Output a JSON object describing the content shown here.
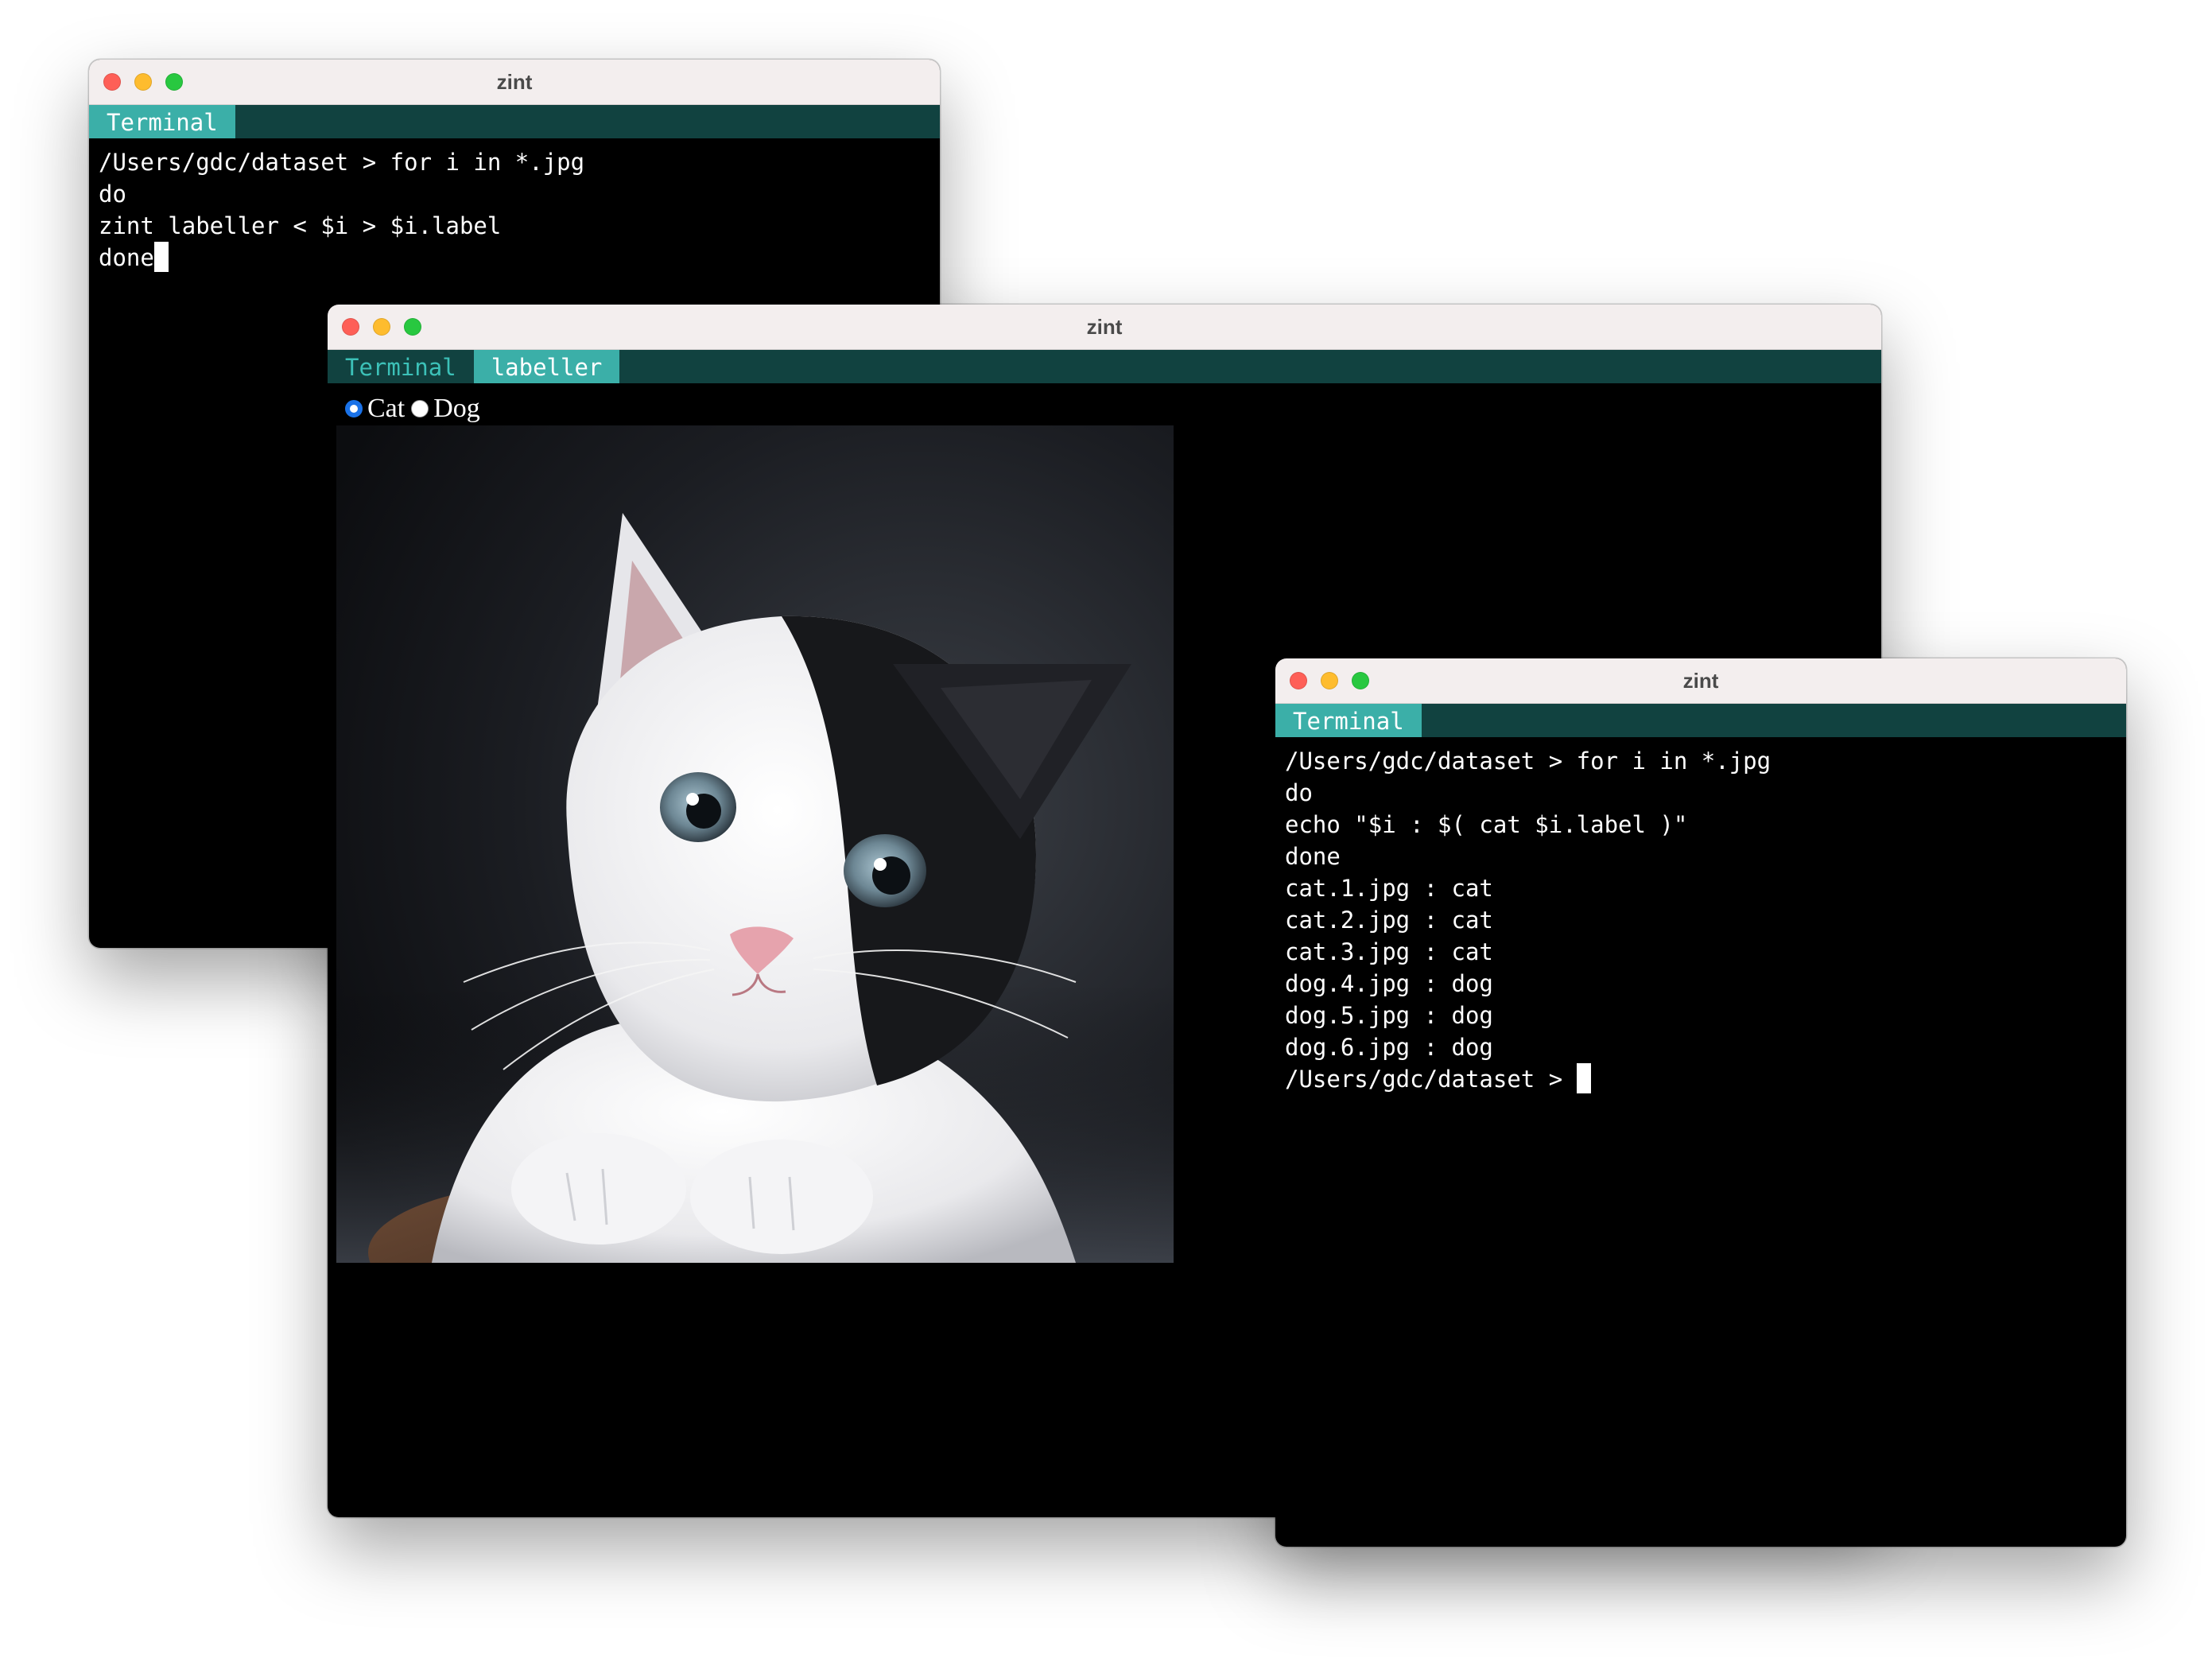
{
  "window_back": {
    "title": "zint",
    "tabs": [
      {
        "label": "Terminal",
        "active": true
      }
    ],
    "lines": [
      "/Users/gdc/dataset > for i in *.jpg",
      "do",
      "zint labeller < $i > $i.label",
      "done"
    ]
  },
  "window_middle": {
    "title": "zint",
    "tabs": [
      {
        "label": "Terminal",
        "active": false
      },
      {
        "label": "labeller",
        "active": true
      }
    ],
    "radio_options": [
      {
        "label": "Cat",
        "checked": true
      },
      {
        "label": "Dog",
        "checked": false
      }
    ]
  },
  "window_front": {
    "title": "zint",
    "tabs": [
      {
        "label": "Terminal",
        "active": true
      }
    ],
    "lines": [
      "/Users/gdc/dataset > for i in *.jpg",
      "do",
      "echo \"$i : $( cat $i.label )\"",
      "done",
      "cat.1.jpg : cat",
      "cat.2.jpg : cat",
      "cat.3.jpg : cat",
      "dog.4.jpg : dog",
      "dog.5.jpg : dog",
      "dog.6.jpg : dog",
      "/Users/gdc/dataset > "
    ]
  },
  "colors": {
    "tabbar": "#114240",
    "tab_active": "#3bafa8",
    "tab_text": "#3cc1b8",
    "titlebar": "#f3eeee"
  },
  "icons": [
    "close-light-icon",
    "minimize-light-icon",
    "zoom-light-icon",
    "radio-icon",
    "cursor-icon"
  ]
}
